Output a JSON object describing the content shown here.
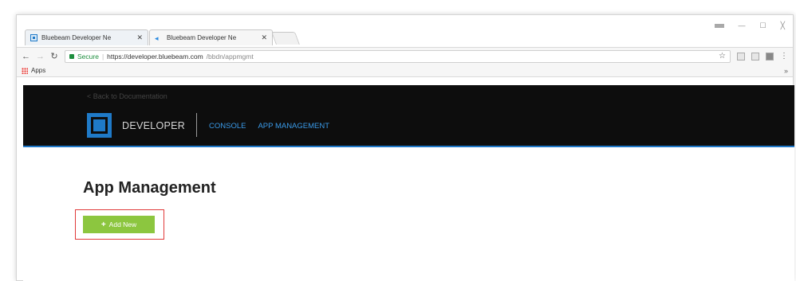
{
  "browser": {
    "tabs": [
      {
        "title": "Bluebeam Developer Ne"
      },
      {
        "title": "Bluebeam Developer Ne"
      }
    ],
    "address": {
      "secure_label": "Secure",
      "url_host": "https://developer.bluebeam.com",
      "url_path": "/bbdn/appmgmt"
    },
    "bookmarks": {
      "apps_label": "Apps",
      "more": "»"
    },
    "window_controls": {
      "minimize": "—",
      "maximize": "☐",
      "close": "╳"
    }
  },
  "site": {
    "back_link": "< Back to Documentation",
    "brand": "DEVELOPER",
    "nav": [
      "CONSOLE",
      "APP MANAGEMENT"
    ]
  },
  "main": {
    "title": "App Management",
    "add_button_label": "Add New"
  },
  "colors": {
    "header_bg": "#0d0d0d",
    "accent_blue": "#1f7ac8",
    "nav_blue": "#3a9ae8",
    "button_green": "#8cc63f",
    "highlight_red": "#e03a3a"
  }
}
